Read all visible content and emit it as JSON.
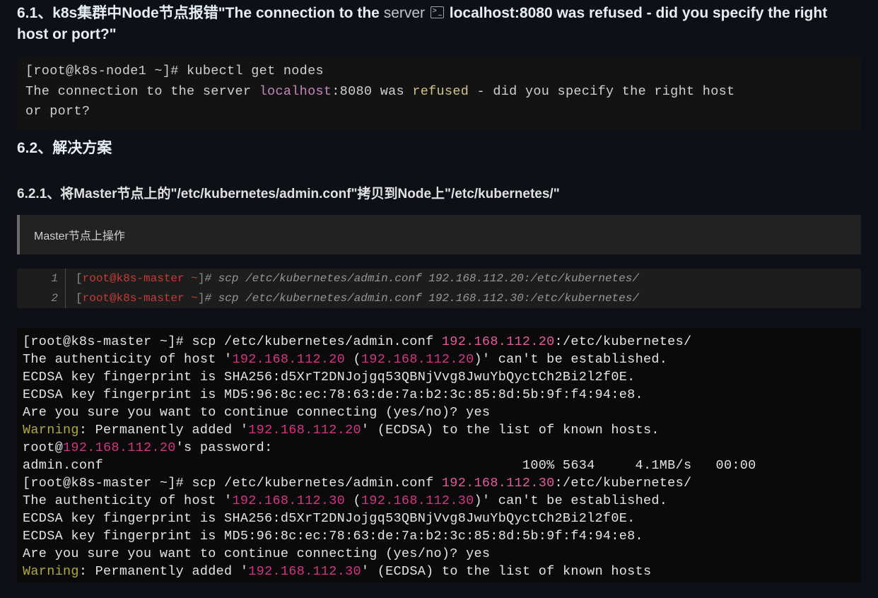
{
  "heading_61_parts": {
    "a": "6.1、k8s集群中Node节点报错\"The connection to the ",
    "server": "server",
    "b": " localhost:8080 was refused - did you specify the right host or port?\""
  },
  "term1": {
    "prompt": "[root@k8s-node1 ~]# ",
    "cmd": "kubectl get nodes",
    "line2a": "The connection to the server ",
    "localhost": "localhost",
    "line2b": ":8080 was ",
    "refused": "refused",
    "line2c": " - did you specify the right host",
    "line3": "or port?"
  },
  "heading_62": "6.2、解决方案",
  "heading_621": "6.2.1、将Master节点上的\"/etc/kubernetes/admin.conf\"拷贝到Node上\"/etc/kubernetes/\"",
  "blockquote": "Master节点上操作",
  "codelines": [
    {
      "n": "1",
      "br1": "[",
      "user": "root@k8s-master ~",
      "br2": "]",
      "hash": "# ",
      "cmd": "scp /etc/kubernetes/admin.conf 192.168.112.20:/etc/kubernetes/"
    },
    {
      "n": "2",
      "br1": "[",
      "user": "root@k8s-master ~",
      "br2": "]",
      "hash": "# ",
      "cmd": "scp /etc/kubernetes/admin.conf 192.168.112.30:/etc/kubernetes/"
    }
  ],
  "term2": {
    "l1a": "[root@k8s-master ~]# scp /etc/kubernetes/admin.conf ",
    "l1b": "192.168.112.20",
    "l1c": ":/etc/kubernetes/",
    "l2a": "The authenticity of host '",
    "l2b": "192.168.112.20",
    "l2c": " (",
    "l2d": "192.168.112.20",
    "l2e": ")' can't be established.",
    "l3": "ECDSA key fingerprint is SHA256:d5XrT2DNJojgq53QBNjVvg8JwuYbQyctCh2Bi2l2f0E.",
    "l4": "ECDSA key fingerprint is MD5:96:8c:ec:78:63:de:7a:b2:3c:85:8d:5b:9f:f4:94:e8.",
    "l5": "Are you sure you want to continue connecting (yes/no)? yes",
    "l6a": "Warning",
    "l6b": ": Permanently added '",
    "l6c": "192.168.112.20",
    "l6d": "' (ECDSA) to the list of known hosts.",
    "l7a": "root@",
    "l7b": "192.168.112.20",
    "l7c": "'s password:",
    "l8": "admin.conf                                                    100% 5634     4.1MB/s   00:00",
    "l9a": "[root@k8s-master ~]# scp /etc/kubernetes/admin.conf ",
    "l9b": "192.168.112.30",
    "l9c": ":/etc/kubernetes/",
    "l10a": "The authenticity of host '",
    "l10b": "192.168.112.30",
    "l10c": " (",
    "l10d": "192.168.112.30",
    "l10e": ")' can't be established.",
    "l11": "ECDSA key fingerprint is SHA256:d5XrT2DNJojgq53QBNjVvg8JwuYbQyctCh2Bi2l2f0E.",
    "l12": "ECDSA key fingerprint is MD5:96:8c:ec:78:63:de:7a:b2:3c:85:8d:5b:9f:f4:94:e8.",
    "l13": "Are you sure you want to continue connecting (yes/no)? yes",
    "l14a": "Warning",
    "l14b": ": Permanently added '",
    "l14c": "192.168.112.30",
    "l14d": "' (ECDSA) to the list of known hosts"
  }
}
